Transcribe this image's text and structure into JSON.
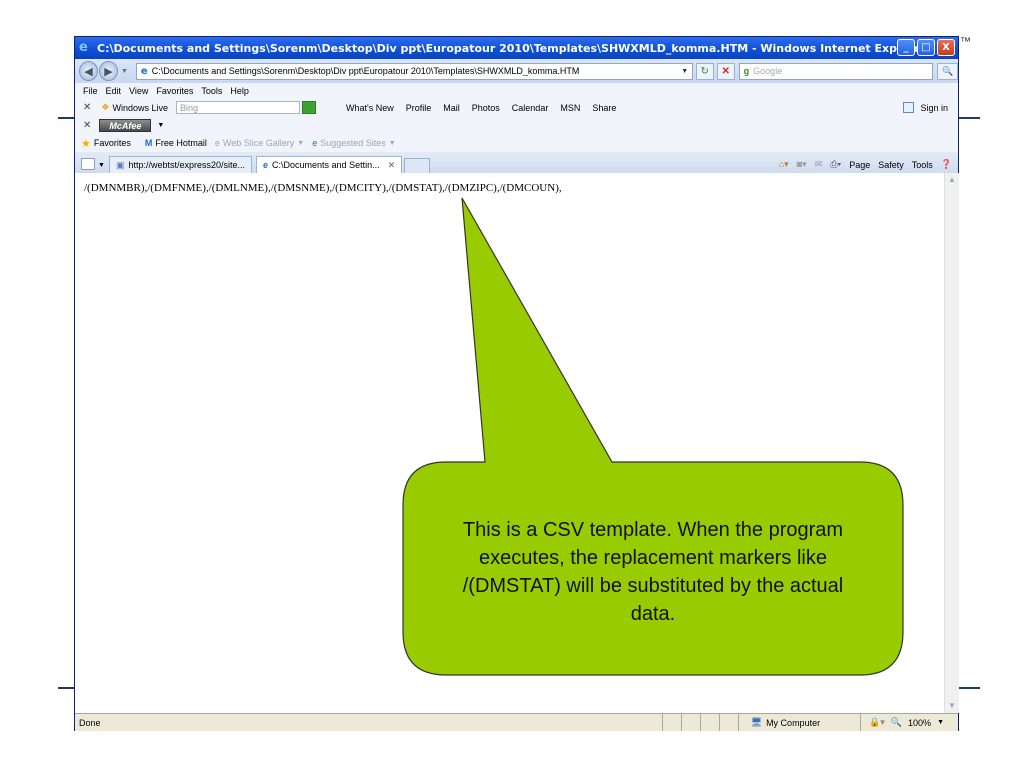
{
  "slide": {
    "trademark": "™"
  },
  "window": {
    "title": "C:\\Documents and Settings\\Sorenm\\Desktop\\Div ppt\\Europatour 2010\\Templates\\SHWXMLD_komma.HTM - Windows Internet Explorer",
    "buttons": {
      "minimize": "_",
      "maximize": "□",
      "close": "X"
    }
  },
  "address_bar": {
    "url": "C:\\Documents and Settings\\Sorenm\\Desktop\\Div ppt\\Europatour 2010\\Templates\\SHWXMLD_komma.HTM",
    "search_placeholder": "Google"
  },
  "menu": [
    "File",
    "Edit",
    "View",
    "Favorites",
    "Tools",
    "Help"
  ],
  "links_bar": {
    "windows_live": "Windows Live",
    "bing_placeholder": "Bing",
    "links": [
      "What's New",
      "Profile",
      "Mail",
      "Photos",
      "Calendar",
      "MSN",
      "Share"
    ],
    "sign_in": "Sign in"
  },
  "mcafee": {
    "label": "McAfee"
  },
  "favorites_bar": {
    "favorites": "Favorites",
    "items": [
      "Free Hotmail",
      "Web Slice Gallery",
      "Suggested Sites"
    ]
  },
  "tabs": [
    {
      "label": "http://webtst/express20/site...",
      "active": false
    },
    {
      "label": "C:\\Documents and Settin...",
      "active": true
    }
  ],
  "command_bar": [
    "Page",
    "Safety",
    "Tools"
  ],
  "content": {
    "text": "/(DMNMBR),/(DMFNME),/(DMLNME),/(DMSNME),/(DMCITY),/(DMSTAT),/(DMZIPC),/(DMCOUN),"
  },
  "status_bar": {
    "status": "Done",
    "zone": "My Computer",
    "zoom": "100%"
  },
  "callout": {
    "text": "This is a CSV template. When the program executes, the replacement markers like /(DMSTAT) will be substituted by the actual data.",
    "fill": "#99cc00",
    "stroke": "#333333"
  }
}
